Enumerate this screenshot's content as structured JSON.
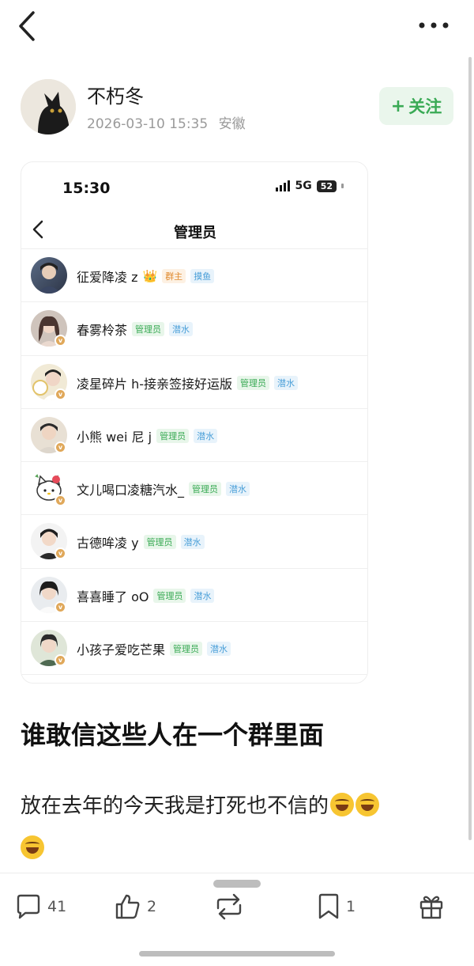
{
  "author": {
    "name": "不朽冬",
    "date": "2026-03-10 15:35",
    "location": "安徽",
    "follow_label": "关注",
    "avatar_icon": "black-cat-avatar"
  },
  "screenshot": {
    "status_time": "15:30",
    "network": "5G",
    "battery": "52",
    "title": "管理员",
    "members": [
      {
        "name": "征爱降凌 z",
        "crown": "👑",
        "tags": [
          "群主",
          "摸鱼"
        ]
      },
      {
        "name": "春雾柃茶",
        "tags": [
          "管理员",
          "潜水"
        ]
      },
      {
        "name": "凌星碎片 h-接亲签接好运版",
        "tags": [
          "管理员",
          "潜水"
        ]
      },
      {
        "name": "小熊 wei 尼 j",
        "tags": [
          "管理员",
          "潜水"
        ]
      },
      {
        "name": "文儿喝口凌糖汽水_",
        "tags": [
          "管理员",
          "潜水"
        ]
      },
      {
        "name": "古德哞凌 y",
        "tags": [
          "管理员",
          "潜水"
        ]
      },
      {
        "name": "喜喜睡了 oO",
        "tags": [
          "管理员",
          "潜水"
        ]
      },
      {
        "name": "小孩子爱吃芒果",
        "tags": [
          "管理员",
          "潜水"
        ]
      }
    ]
  },
  "post": {
    "title": "谁敢信这些人在一个群里面",
    "body": "放在去年的今天我是打死也不信的",
    "emoji_name": "rofl-emoji"
  },
  "actions": {
    "comments": "41",
    "likes": "2",
    "bookmarks": "1"
  },
  "colors": {
    "accent_green": "#3aaa55",
    "owner_tag": "#e08a2e",
    "lurk_tag": "#4a9fd8"
  }
}
